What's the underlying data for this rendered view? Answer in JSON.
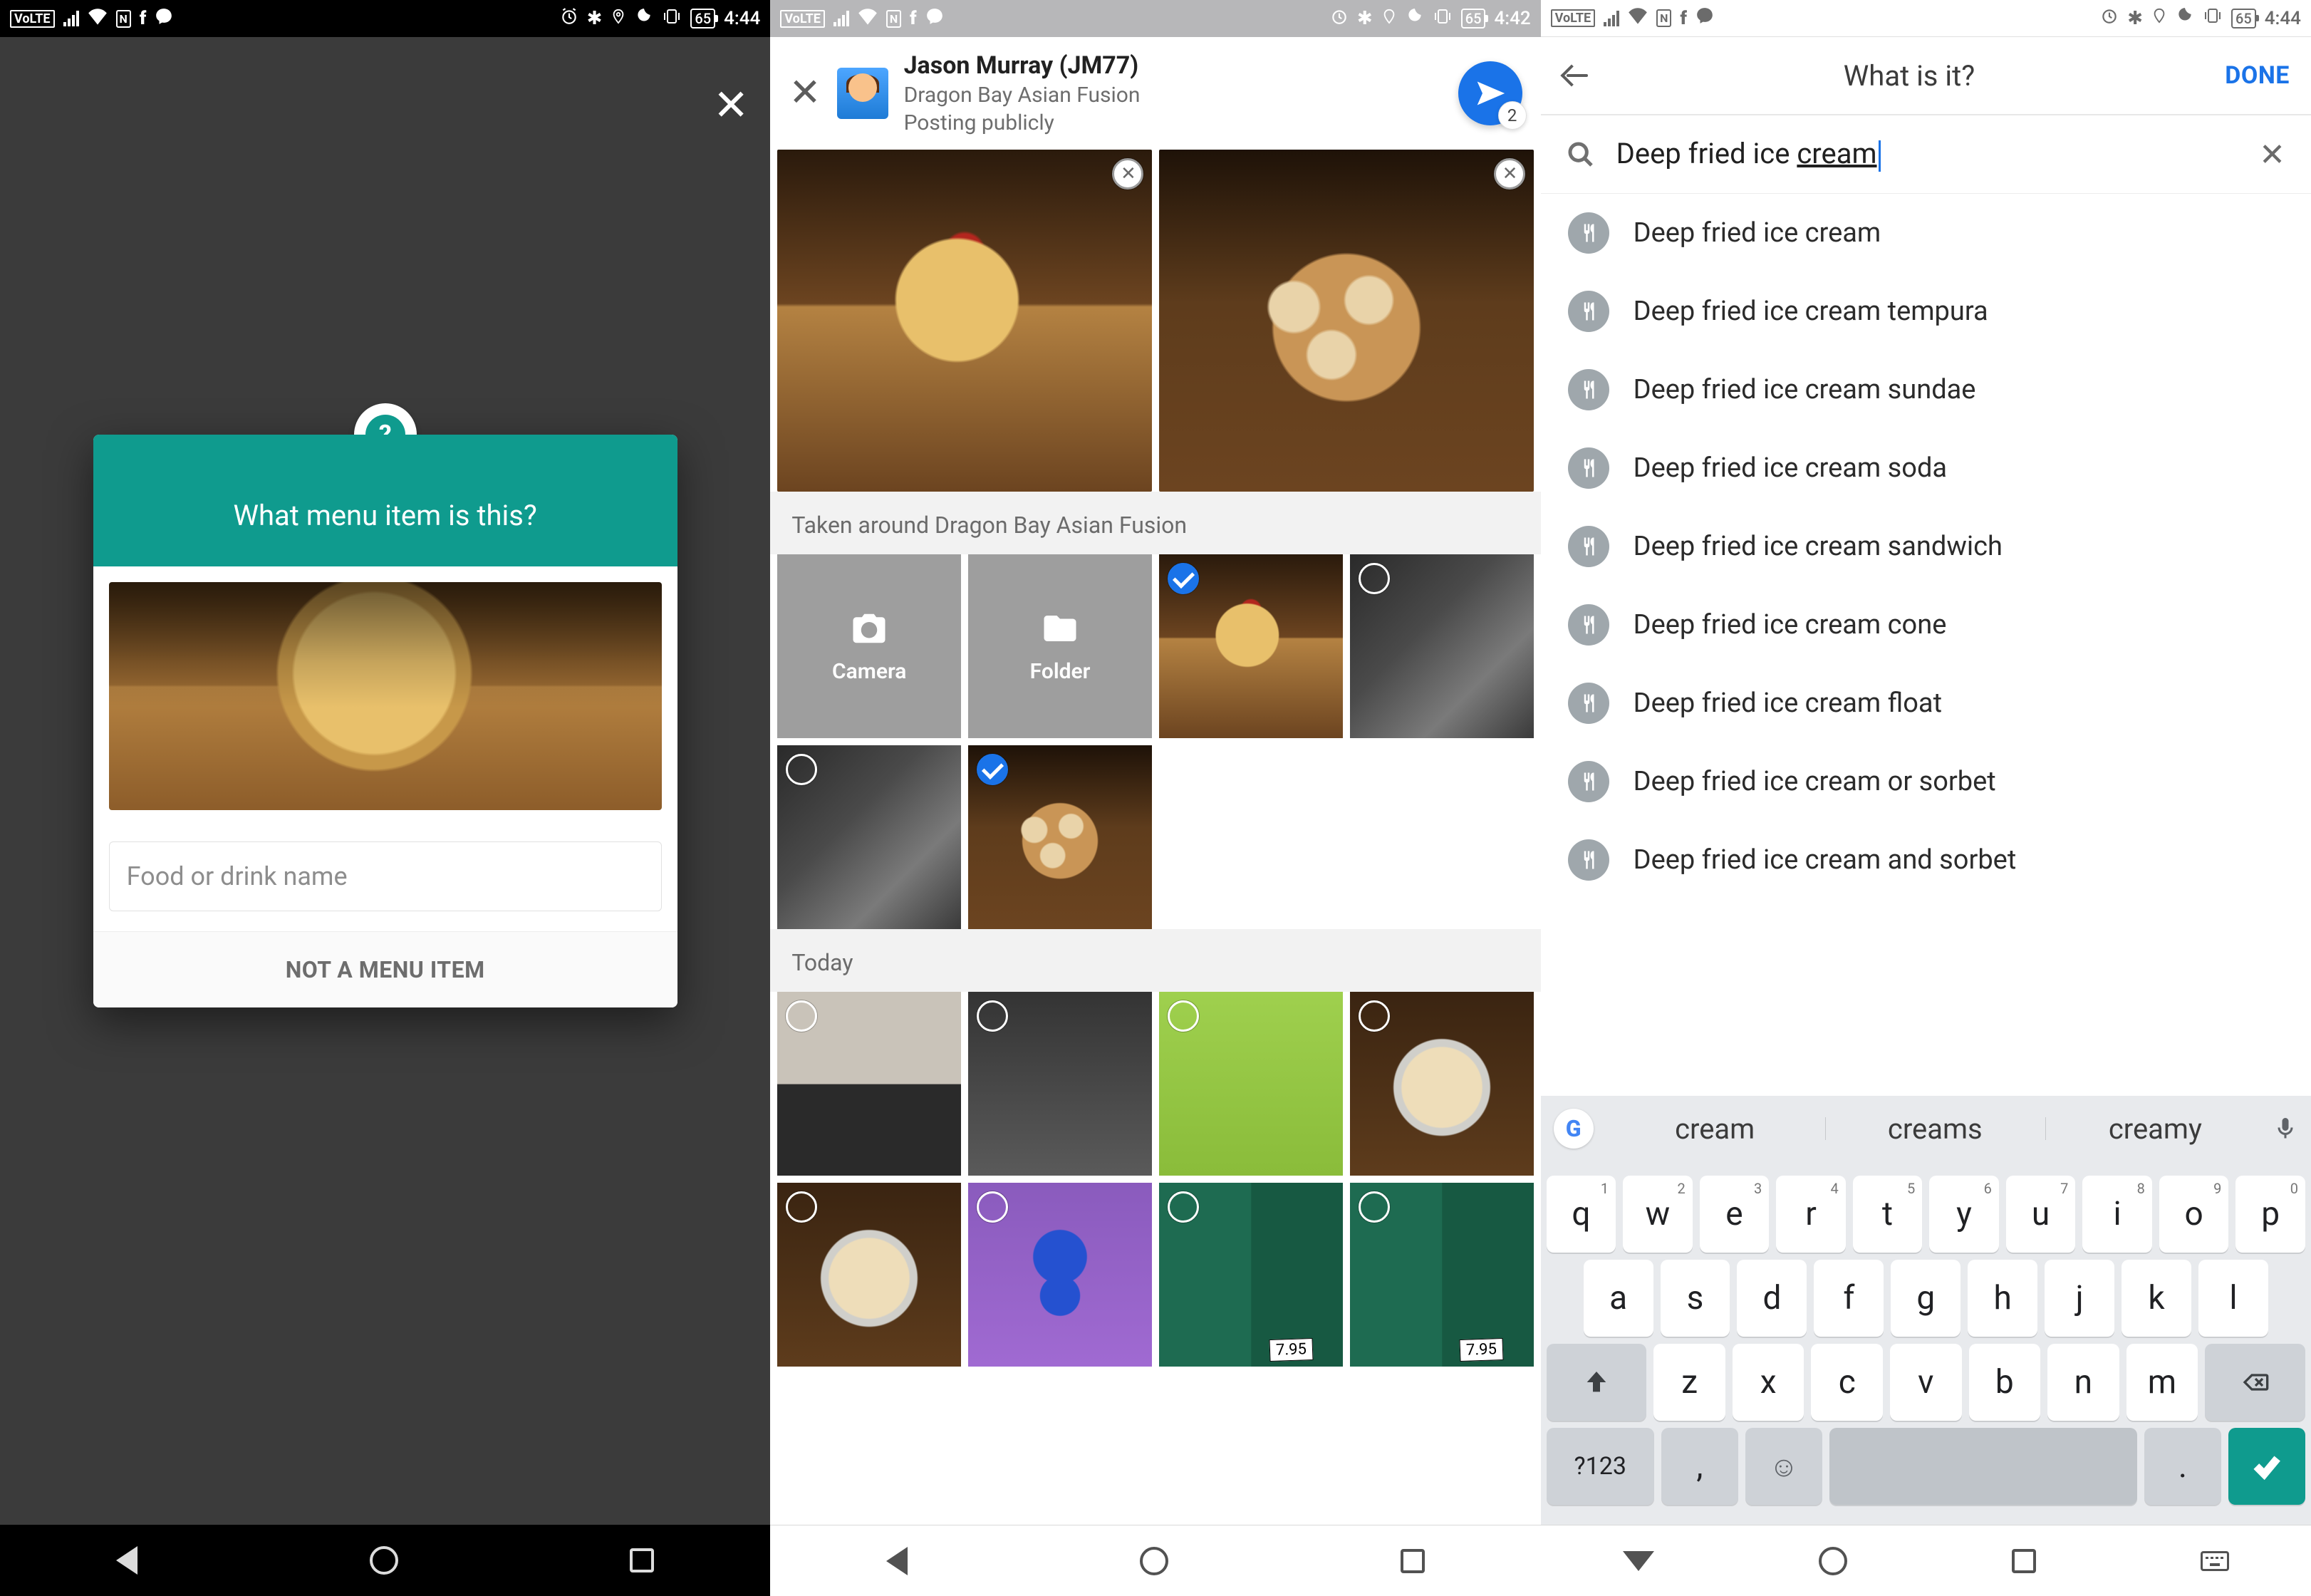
{
  "status": {
    "time_a": "4:44",
    "time_b": "4:42",
    "time_c": "4:44",
    "battery": "65",
    "volte": "VoLTE"
  },
  "screen1": {
    "dialog_title": "What menu item is this?",
    "placeholder": "Food or drink name",
    "not_menu": "NOT A MENU ITEM",
    "qmark": "?"
  },
  "screen2": {
    "user_name": "Jason Murray (JM77)",
    "place": "Dragon Bay Asian Fusion",
    "visibility": "Posting publicly",
    "badge_count": "2",
    "section_nearby": "Taken around Dragon Bay Asian Fusion",
    "camera_label": "Camera",
    "folder_label": "Folder",
    "section_today": "Today",
    "price": "7.95"
  },
  "screen3": {
    "title": "What is it?",
    "done": "DONE",
    "query_head": "Deep fried ice ",
    "query_tail": "cream",
    "suggestions": [
      "Deep fried ice cream",
      "Deep fried ice cream tempura",
      "Deep fried ice cream sundae",
      "Deep fried ice cream soda",
      "Deep fried ice cream sandwich",
      "Deep fried ice cream cone",
      "Deep fried ice cream float",
      "Deep fried ice cream or sorbet",
      "Deep fried ice cream and sorbet"
    ],
    "kb_suggestions": [
      "cream",
      "creams",
      "creamy"
    ],
    "keys_r1": [
      "q",
      "w",
      "e",
      "r",
      "t",
      "y",
      "u",
      "i",
      "o",
      "p"
    ],
    "keys_r1_sup": [
      "1",
      "2",
      "3",
      "4",
      "5",
      "6",
      "7",
      "8",
      "9",
      "0"
    ],
    "keys_r2": [
      "a",
      "s",
      "d",
      "f",
      "g",
      "h",
      "j",
      "k",
      "l"
    ],
    "keys_r3": [
      "z",
      "x",
      "c",
      "v",
      "b",
      "n",
      "m"
    ],
    "sym": "?123",
    "comma": ",",
    "period": "."
  }
}
